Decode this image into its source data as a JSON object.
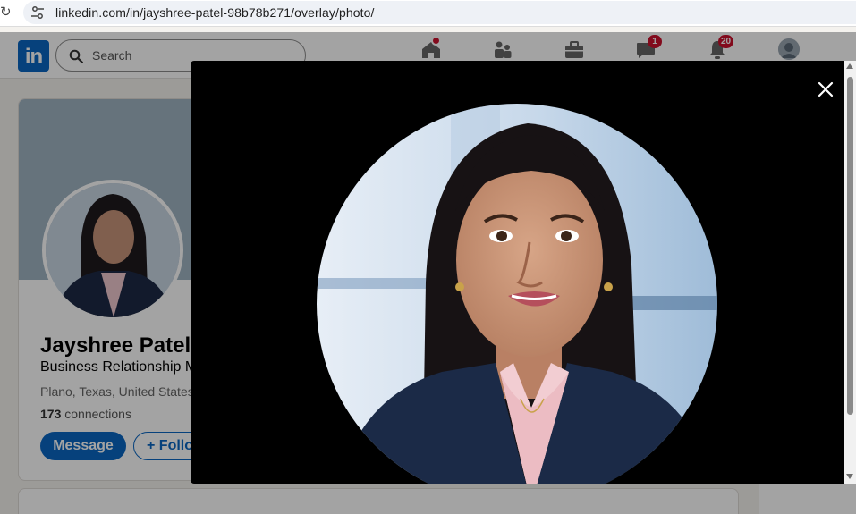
{
  "browser": {
    "url": "linkedin.com/in/jayshree-patel-98b78b271/overlay/photo/",
    "reload_icon": "reload-icon",
    "site_settings_icon": "tune-icon"
  },
  "nav": {
    "logo_text": "in",
    "search_placeholder": "Search",
    "items": [
      {
        "icon": "home-icon",
        "badge": ""
      },
      {
        "icon": "my-network-icon",
        "badge": ""
      },
      {
        "icon": "jobs-briefcase-icon",
        "badge": ""
      },
      {
        "icon": "messaging-icon",
        "badge": "1"
      },
      {
        "icon": "notifications-bell-icon",
        "badge": "20"
      }
    ],
    "accent": "#0a66c2",
    "badge_color": "#cb112d"
  },
  "profile": {
    "name": "Jayshree Patel",
    "headline": "Business Relationship M",
    "location": "Plano, Texas, United States",
    "connections_count": "173",
    "connections_label": "connections",
    "message_label": "Message",
    "follow_label": "+ Follo"
  },
  "overlay": {
    "close_icon": "close-icon",
    "photo_alt": "Jayshree Patel profile photo"
  }
}
